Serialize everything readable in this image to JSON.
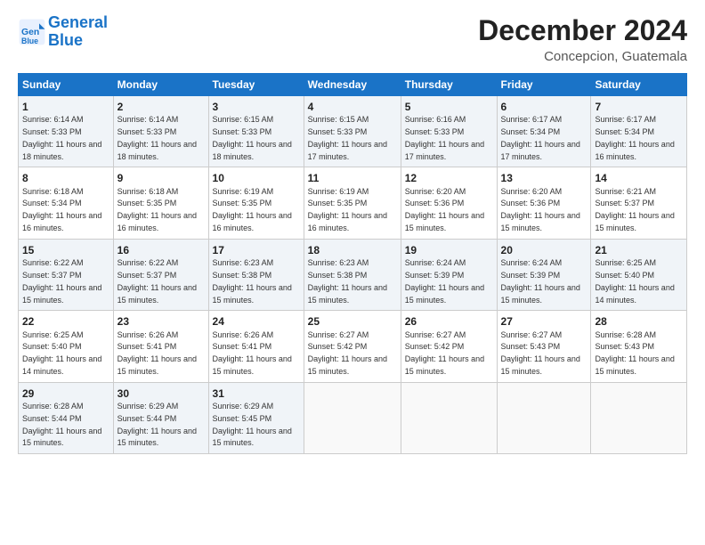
{
  "header": {
    "logo_line1": "General",
    "logo_line2": "Blue",
    "month": "December 2024",
    "location": "Concepcion, Guatemala"
  },
  "weekdays": [
    "Sunday",
    "Monday",
    "Tuesday",
    "Wednesday",
    "Thursday",
    "Friday",
    "Saturday"
  ],
  "weeks": [
    [
      {
        "day": "1",
        "sunrise": "6:14 AM",
        "sunset": "5:33 PM",
        "daylight": "11 hours and 18 minutes."
      },
      {
        "day": "2",
        "sunrise": "6:14 AM",
        "sunset": "5:33 PM",
        "daylight": "11 hours and 18 minutes."
      },
      {
        "day": "3",
        "sunrise": "6:15 AM",
        "sunset": "5:33 PM",
        "daylight": "11 hours and 18 minutes."
      },
      {
        "day": "4",
        "sunrise": "6:15 AM",
        "sunset": "5:33 PM",
        "daylight": "11 hours and 17 minutes."
      },
      {
        "day": "5",
        "sunrise": "6:16 AM",
        "sunset": "5:33 PM",
        "daylight": "11 hours and 17 minutes."
      },
      {
        "day": "6",
        "sunrise": "6:17 AM",
        "sunset": "5:34 PM",
        "daylight": "11 hours and 17 minutes."
      },
      {
        "day": "7",
        "sunrise": "6:17 AM",
        "sunset": "5:34 PM",
        "daylight": "11 hours and 16 minutes."
      }
    ],
    [
      {
        "day": "8",
        "sunrise": "6:18 AM",
        "sunset": "5:34 PM",
        "daylight": "11 hours and 16 minutes."
      },
      {
        "day": "9",
        "sunrise": "6:18 AM",
        "sunset": "5:35 PM",
        "daylight": "11 hours and 16 minutes."
      },
      {
        "day": "10",
        "sunrise": "6:19 AM",
        "sunset": "5:35 PM",
        "daylight": "11 hours and 16 minutes."
      },
      {
        "day": "11",
        "sunrise": "6:19 AM",
        "sunset": "5:35 PM",
        "daylight": "11 hours and 16 minutes."
      },
      {
        "day": "12",
        "sunrise": "6:20 AM",
        "sunset": "5:36 PM",
        "daylight": "11 hours and 15 minutes."
      },
      {
        "day": "13",
        "sunrise": "6:20 AM",
        "sunset": "5:36 PM",
        "daylight": "11 hours and 15 minutes."
      },
      {
        "day": "14",
        "sunrise": "6:21 AM",
        "sunset": "5:37 PM",
        "daylight": "11 hours and 15 minutes."
      }
    ],
    [
      {
        "day": "15",
        "sunrise": "6:22 AM",
        "sunset": "5:37 PM",
        "daylight": "11 hours and 15 minutes."
      },
      {
        "day": "16",
        "sunrise": "6:22 AM",
        "sunset": "5:37 PM",
        "daylight": "11 hours and 15 minutes."
      },
      {
        "day": "17",
        "sunrise": "6:23 AM",
        "sunset": "5:38 PM",
        "daylight": "11 hours and 15 minutes."
      },
      {
        "day": "18",
        "sunrise": "6:23 AM",
        "sunset": "5:38 PM",
        "daylight": "11 hours and 15 minutes."
      },
      {
        "day": "19",
        "sunrise": "6:24 AM",
        "sunset": "5:39 PM",
        "daylight": "11 hours and 15 minutes."
      },
      {
        "day": "20",
        "sunrise": "6:24 AM",
        "sunset": "5:39 PM",
        "daylight": "11 hours and 15 minutes."
      },
      {
        "day": "21",
        "sunrise": "6:25 AM",
        "sunset": "5:40 PM",
        "daylight": "11 hours and 14 minutes."
      }
    ],
    [
      {
        "day": "22",
        "sunrise": "6:25 AM",
        "sunset": "5:40 PM",
        "daylight": "11 hours and 14 minutes."
      },
      {
        "day": "23",
        "sunrise": "6:26 AM",
        "sunset": "5:41 PM",
        "daylight": "11 hours and 15 minutes."
      },
      {
        "day": "24",
        "sunrise": "6:26 AM",
        "sunset": "5:41 PM",
        "daylight": "11 hours and 15 minutes."
      },
      {
        "day": "25",
        "sunrise": "6:27 AM",
        "sunset": "5:42 PM",
        "daylight": "11 hours and 15 minutes."
      },
      {
        "day": "26",
        "sunrise": "6:27 AM",
        "sunset": "5:42 PM",
        "daylight": "11 hours and 15 minutes."
      },
      {
        "day": "27",
        "sunrise": "6:27 AM",
        "sunset": "5:43 PM",
        "daylight": "11 hours and 15 minutes."
      },
      {
        "day": "28",
        "sunrise": "6:28 AM",
        "sunset": "5:43 PM",
        "daylight": "11 hours and 15 minutes."
      }
    ],
    [
      {
        "day": "29",
        "sunrise": "6:28 AM",
        "sunset": "5:44 PM",
        "daylight": "11 hours and 15 minutes."
      },
      {
        "day": "30",
        "sunrise": "6:29 AM",
        "sunset": "5:44 PM",
        "daylight": "11 hours and 15 minutes."
      },
      {
        "day": "31",
        "sunrise": "6:29 AM",
        "sunset": "5:45 PM",
        "daylight": "11 hours and 15 minutes."
      },
      null,
      null,
      null,
      null
    ]
  ]
}
